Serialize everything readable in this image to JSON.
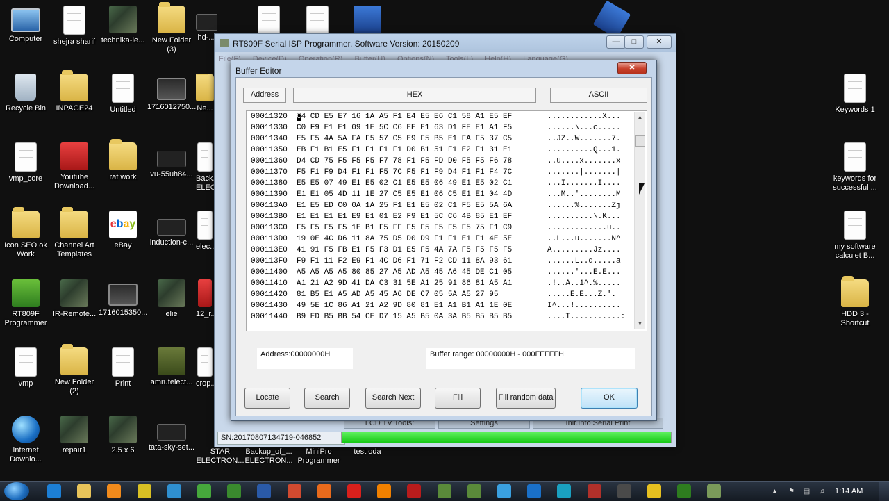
{
  "desktop": {
    "icons": [
      {
        "label": "Computer",
        "icon": "computer-icon"
      },
      {
        "label": "shejra sharif",
        "icon": "document-icon"
      },
      {
        "label": "technika-le...",
        "icon": "photo-icon"
      },
      {
        "label": "New Folder (3)",
        "icon": "folder-icon"
      },
      {
        "label": "hd-...",
        "icon": "device-icon"
      },
      {
        "label": "Recycle Bin",
        "icon": "recycle-bin-icon"
      },
      {
        "label": "INPAGE24",
        "icon": "folder-icon"
      },
      {
        "label": "Untitled",
        "icon": "document-icon"
      },
      {
        "label": "1716012750...",
        "icon": "monitor-icon"
      },
      {
        "label": "Ne...",
        "icon": "folder-icon"
      },
      {
        "label": "vmp_core",
        "icon": "document-icon"
      },
      {
        "label": "Youtube Download...",
        "icon": "youtube-downloader-icon"
      },
      {
        "label": "raf work",
        "icon": "folder-icon"
      },
      {
        "label": "vu-55uh84...",
        "icon": "photo-icon"
      },
      {
        "label": "Back... ELEC...",
        "icon": "document-icon"
      },
      {
        "label": "Icon SEO ok Work",
        "icon": "folder-icon"
      },
      {
        "label": "Channel Art Templates",
        "icon": "folder-icon"
      },
      {
        "label": "eBay",
        "icon": "ebay-icon"
      },
      {
        "label": "induction-c...",
        "icon": "device-icon"
      },
      {
        "label": "elec...",
        "icon": "document-icon"
      },
      {
        "label": "RT809F Programmer",
        "icon": "rt809f-icon"
      },
      {
        "label": "IR-Remote...",
        "icon": "photo-icon"
      },
      {
        "label": "1716015350...",
        "icon": "monitor-icon"
      },
      {
        "label": "elie",
        "icon": "photo-icon"
      },
      {
        "label": "12_r...",
        "icon": "document-icon"
      },
      {
        "label": "vmp",
        "icon": "document-icon"
      },
      {
        "label": "New Folder (2)",
        "icon": "folder-icon"
      },
      {
        "label": "Print",
        "icon": "document-icon"
      },
      {
        "label": "amrutelect...",
        "icon": "chip-icon"
      },
      {
        "label": "crop...",
        "icon": "document-icon"
      },
      {
        "label": "Internet Downlo...",
        "icon": "globe-icon"
      },
      {
        "label": "repair1",
        "icon": "photo-icon"
      },
      {
        "label": "2.5 x 6",
        "icon": "photo-icon"
      },
      {
        "label": "tata-sky-set...",
        "icon": "device-icon"
      },
      {
        "label": "STAR ELECTRON...",
        "icon": "document-icon"
      },
      {
        "label": "Backup_of_... ELECTRON...",
        "icon": "document-icon"
      },
      {
        "label": "MiniPro Programmer",
        "icon": "document-icon"
      },
      {
        "label": "test oda",
        "icon": "document-icon"
      },
      {
        "label": "Keywords 1",
        "icon": "document-icon"
      },
      {
        "label": "keywords for successful ...",
        "icon": "document-icon"
      },
      {
        "label": "my software calculet B...",
        "icon": "spreadsheet-icon"
      },
      {
        "label": "HDD 3 - Shortcut",
        "icon": "folder-icon"
      }
    ]
  },
  "app": {
    "title": "RT809F Serial ISP Programmer. Software Version: 20150209",
    "menu": [
      "File(F)",
      "Device(D)",
      "Operation(R)",
      "Buffer(U)",
      "Options(N)",
      "Tools(L)",
      "Help(H)",
      "Language(G)"
    ],
    "status_serial": "SN:20170807134719-046852",
    "progress_fraction": 1.0,
    "background_buttons": [
      "LCD TV Tools:",
      "Settings",
      "Init.Info Serial Print"
    ]
  },
  "dialog": {
    "title": "Buffer Editor",
    "headers": {
      "address": "Address",
      "hex": "HEX",
      "ascii": "ASCII"
    },
    "rows": [
      {
        "addr": "00011320",
        "hex": "C4 CD E5 E7 16 1A A5 F1 E4 E5 E6 C1 58 A1 E5 EF",
        "ascii": "............X..."
      },
      {
        "addr": "00011330",
        "hex": "C0 F9 E1 E1 09 1E 5C C6 EE E1 63 D1 FE E1 A1 F5",
        "ascii": "......\\...c....."
      },
      {
        "addr": "00011340",
        "hex": "E5 F5 4A 5A FA F5 57 C5 E9 F5 B5 E1 FA F5 37 C5",
        "ascii": "..JZ..W.......7."
      },
      {
        "addr": "00011350",
        "hex": "EB F1 B1 E5 F1 F1 F1 F1 D0 B1 51 F1 E2 F1 31 E1",
        "ascii": "..........Q...1."
      },
      {
        "addr": "00011360",
        "hex": "D4 CD 75 F5 F5 F5 F7 78 F1 F5 FD D0 F5 F5 F6 78",
        "ascii": "..u....x.......x"
      },
      {
        "addr": "00011370",
        "hex": "F5 F1 F9 D4 F1 F1 F5 7C F5 F1 F9 D4 F1 F1 F4 7C",
        "ascii": ".......|.......|"
      },
      {
        "addr": "00011380",
        "hex": "E5 E5 07 49 E1 E5 02 C1 E5 E5 06 49 E1 E5 02 C1",
        "ascii": "...I.......I...."
      },
      {
        "addr": "00011390",
        "hex": "E1 E1 05 4D 11 1E 27 C5 E5 E1 06 C5 E1 E1 04 4D",
        "ascii": "...M..'........M"
      },
      {
        "addr": "000113A0",
        "hex": "E1 E5 ED C0 0A 1A 25 F1 E1 E5 02 C1 F5 E5 5A 6A",
        "ascii": "......%.......Zj"
      },
      {
        "addr": "000113B0",
        "hex": "E1 E1 E1 E1 E9 E1 01 E2 F9 E1 5C C6 4B 85 E1 EF",
        "ascii": "..........\\.K..."
      },
      {
        "addr": "000113C0",
        "hex": "F5 F5 F5 F5 1E B1 F5 FF F5 F5 F5 F5 F5 75 F1 C9",
        "ascii": ".............u.."
      },
      {
        "addr": "000113D0",
        "hex": "19 0E 4C D6 11 8A 75 D5 D0 D9 F1 F1 E1 F1 4E 5E",
        "ascii": "..L...u.......N^"
      },
      {
        "addr": "000113E0",
        "hex": "41 91 F5 FB E1 F5 F3 D1 E5 F5 4A 7A F5 F5 F5 F5",
        "ascii": "A.........Jz...."
      },
      {
        "addr": "000113F0",
        "hex": "F9 F1 11 F2 E9 F1 4C D6 F1 71 F2 CD 11 8A 93 61",
        "ascii": "......L..q.....a"
      },
      {
        "addr": "00011400",
        "hex": "A5 A5 A5 A5 80 85 27 A5 AD A5 45 A6 45 DE C1 05",
        "ascii": "......'...E.E..."
      },
      {
        "addr": "00011410",
        "hex": "A1 21 A2 9D 41 DA C3 31 5E A1 25 91 86 81 A5 A1",
        "ascii": ".!..A..1^.%....."
      },
      {
        "addr": "00011420",
        "hex": "81 B5 E1 A5 AD A5 45 A6 DE C7 05 5A A5 27 95",
        "ascii": ".....E.E...Z.'."
      },
      {
        "addr": "00011430",
        "hex": "49 5E 1C 86 A1 21 A2 9D 80 81 E1 A1 B1 A1 1E 0E",
        "ascii": "I^...!.........."
      },
      {
        "addr": "00011440",
        "hex": "B9 ED B5 BB 54 CE D7 15 A5 B5 0A 3A B5 B5 B5 B5",
        "ascii": "....T...........:"
      }
    ],
    "address_field": "Address:00000000H",
    "buffer_range": "Buffer range: 00000000H - 000FFFFFH",
    "buttons": {
      "locate": "Locate",
      "search": "Search",
      "search_next": "Search Next",
      "fill": "Fill",
      "fill_random": "Fill random data",
      "ok": "OK"
    }
  },
  "taskbar": {
    "time": "1:14 AM",
    "apps": [
      "ie-icon",
      "explorer-icon",
      "media-player-icon",
      "app-icon",
      "app-icon",
      "app-icon",
      "app-icon",
      "app-icon",
      "chrome-icon",
      "firefox-icon",
      "opera-icon",
      "vlc-icon",
      "app-icon",
      "app-icon",
      "app-icon",
      "app-icon",
      "app-icon",
      "app-icon",
      "app-icon",
      "app-icon",
      "app-icon",
      "app-icon",
      "app-icon"
    ]
  }
}
